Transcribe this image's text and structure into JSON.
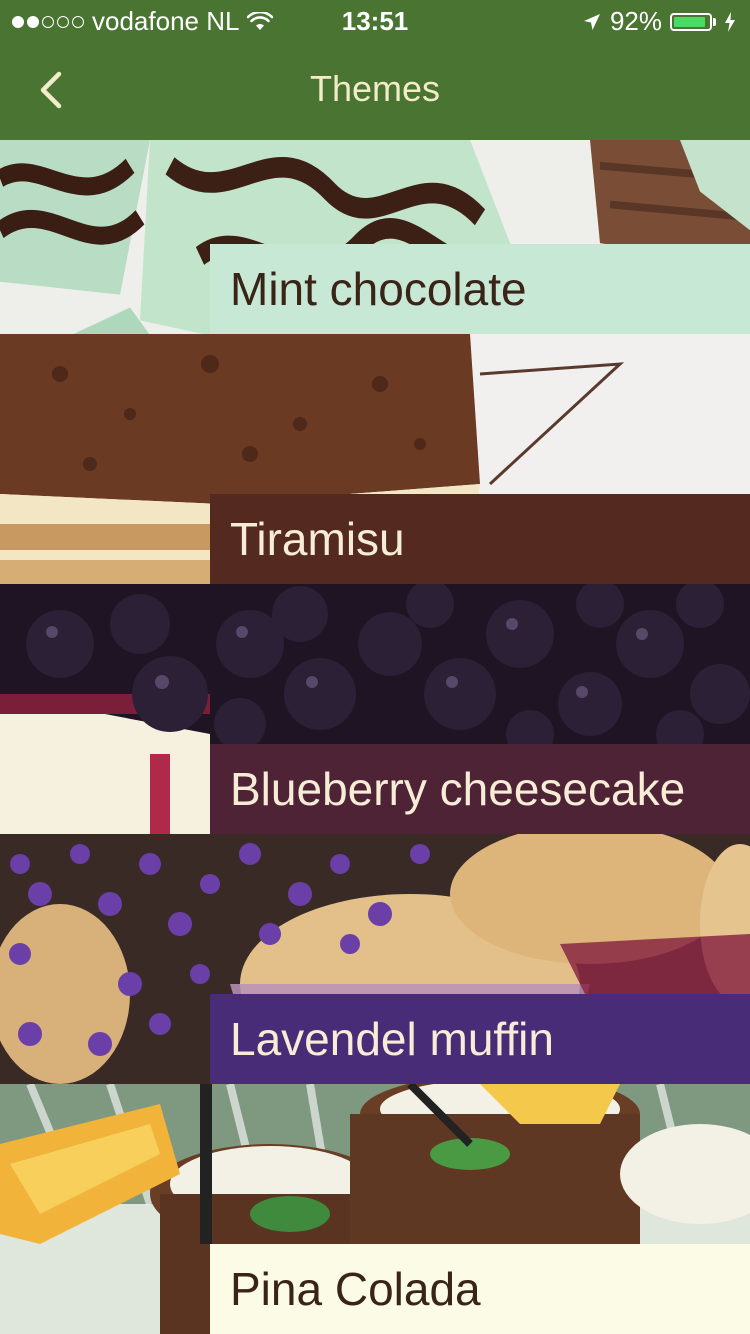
{
  "status_bar": {
    "carrier": "vodafone NL",
    "signal_bars_filled": 2,
    "signal_bars_total": 5,
    "time": "13:51",
    "battery_percent": "92%",
    "battery_level": 0.92
  },
  "nav": {
    "title": "Themes",
    "back_icon": "chevron-left-icon"
  },
  "colors": {
    "bar_bg": "#4a7432",
    "title_color": "#f2ecc8"
  },
  "themes": [
    {
      "name": "Mint chocolate",
      "label_bg": "#c6e8d4",
      "label_color": "#3a2418"
    },
    {
      "name": "Tiramisu",
      "label_bg": "#542a20",
      "label_color": "#f7ecd6"
    },
    {
      "name": "Blueberry cheesecake",
      "label_bg": "#4e2336",
      "label_color": "#f7ecd6"
    },
    {
      "name": "Lavendel muffin",
      "label_bg": "#482c78",
      "label_color": "#f7ecd6"
    },
    {
      "name": "Pina Colada",
      "label_bg": "#fbfbe6",
      "label_color": "#3a2418"
    }
  ]
}
